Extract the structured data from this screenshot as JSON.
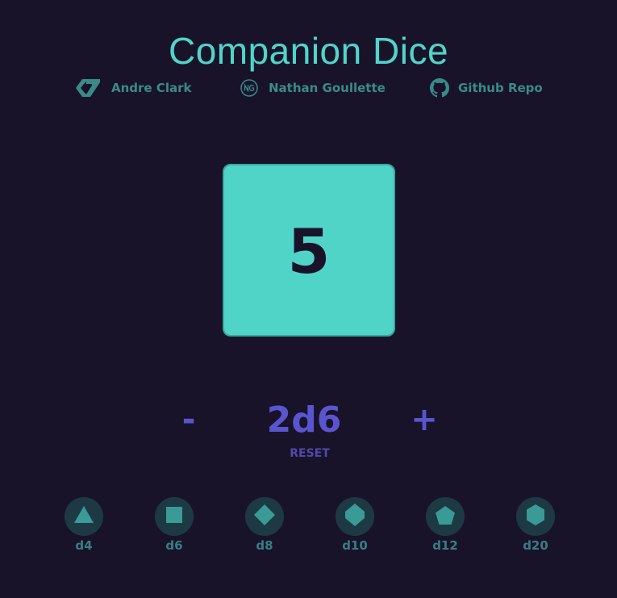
{
  "header": {
    "title": "Companion Dice"
  },
  "credits": [
    {
      "label": "Andre Clark",
      "icon": "andre-logo-icon"
    },
    {
      "label": "Nathan Goullette",
      "icon": "nathan-logo-icon"
    },
    {
      "label": "Github Repo",
      "icon": "github-icon"
    }
  ],
  "roll": {
    "result": "5"
  },
  "controls": {
    "decrement_label": "-",
    "notation": "2d6",
    "increment_label": "+",
    "reset_label": "RESET"
  },
  "dice_options": [
    {
      "label": "d4",
      "icon": "triangle-icon"
    },
    {
      "label": "d6",
      "icon": "square-icon"
    },
    {
      "label": "d8",
      "icon": "diamond-icon"
    },
    {
      "label": "d10",
      "icon": "kite-icon"
    },
    {
      "label": "d12",
      "icon": "pentagon-icon"
    },
    {
      "label": "d20",
      "icon": "hexagon-icon"
    }
  ],
  "colors": {
    "background": "#19132a",
    "accent_teal": "#4fd5c9",
    "accent_purple": "#5a55cf",
    "muted_teal": "#3a8a8a",
    "die_option_bg": "#1d3a44"
  }
}
